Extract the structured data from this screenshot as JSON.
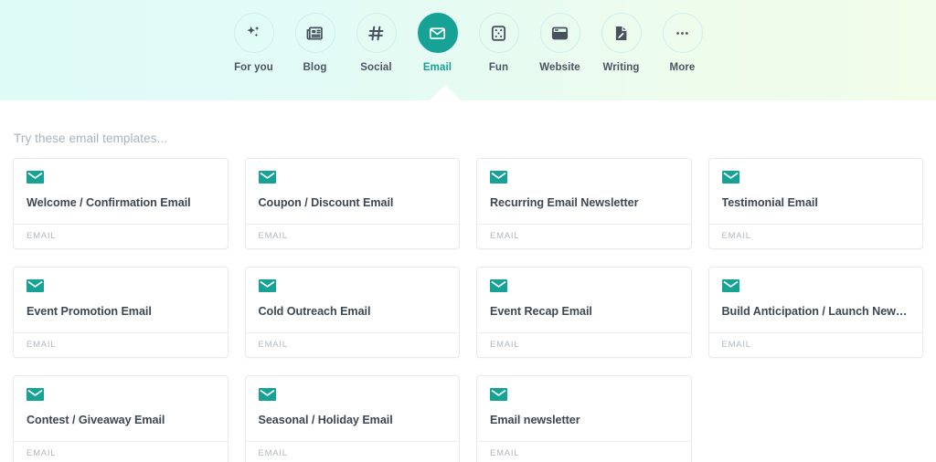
{
  "nav": {
    "items": [
      {
        "label": "For you",
        "icon": "sparkles-icon",
        "active": false
      },
      {
        "label": "Blog",
        "icon": "newspaper-icon",
        "active": false
      },
      {
        "label": "Social",
        "icon": "hash-icon",
        "active": false
      },
      {
        "label": "Email",
        "icon": "envelope-icon",
        "active": true
      },
      {
        "label": "Fun",
        "icon": "dice-icon",
        "active": false
      },
      {
        "label": "Website",
        "icon": "browser-window-icon",
        "active": false
      },
      {
        "label": "Writing",
        "icon": "document-pen-icon",
        "active": false
      },
      {
        "label": "More",
        "icon": "ellipsis-icon",
        "active": false
      }
    ]
  },
  "main": {
    "section_title": "Try these email templates...",
    "cards": [
      {
        "title": "Welcome / Confirmation Email",
        "category": "EMAIL",
        "icon": "envelope-icon"
      },
      {
        "title": "Coupon / Discount Email",
        "category": "EMAIL",
        "icon": "envelope-icon"
      },
      {
        "title": "Recurring Email Newsletter",
        "category": "EMAIL",
        "icon": "envelope-icon"
      },
      {
        "title": "Testimonial Email",
        "category": "EMAIL",
        "icon": "envelope-icon"
      },
      {
        "title": "Event Promotion Email",
        "category": "EMAIL",
        "icon": "envelope-icon"
      },
      {
        "title": "Cold Outreach Email",
        "category": "EMAIL",
        "icon": "envelope-icon"
      },
      {
        "title": "Event Recap Email",
        "category": "EMAIL",
        "icon": "envelope-icon"
      },
      {
        "title": "Build Anticipation / Launch New…",
        "category": "EMAIL",
        "icon": "envelope-icon"
      },
      {
        "title": "Contest / Giveaway Email",
        "category": "EMAIL",
        "icon": "envelope-icon"
      },
      {
        "title": "Seasonal / Holiday Email",
        "category": "EMAIL",
        "icon": "envelope-icon"
      },
      {
        "title": "Email newsletter",
        "category": "EMAIL",
        "icon": "envelope-icon"
      }
    ]
  },
  "colors": {
    "accent": "#16a396",
    "icon_dark": "#47525e",
    "title_text": "#3d4852",
    "muted_text": "#aab2bd",
    "card_border": "#e7eaee",
    "gradient_left": "#dffbf6",
    "gradient_right": "#f2fdea"
  }
}
